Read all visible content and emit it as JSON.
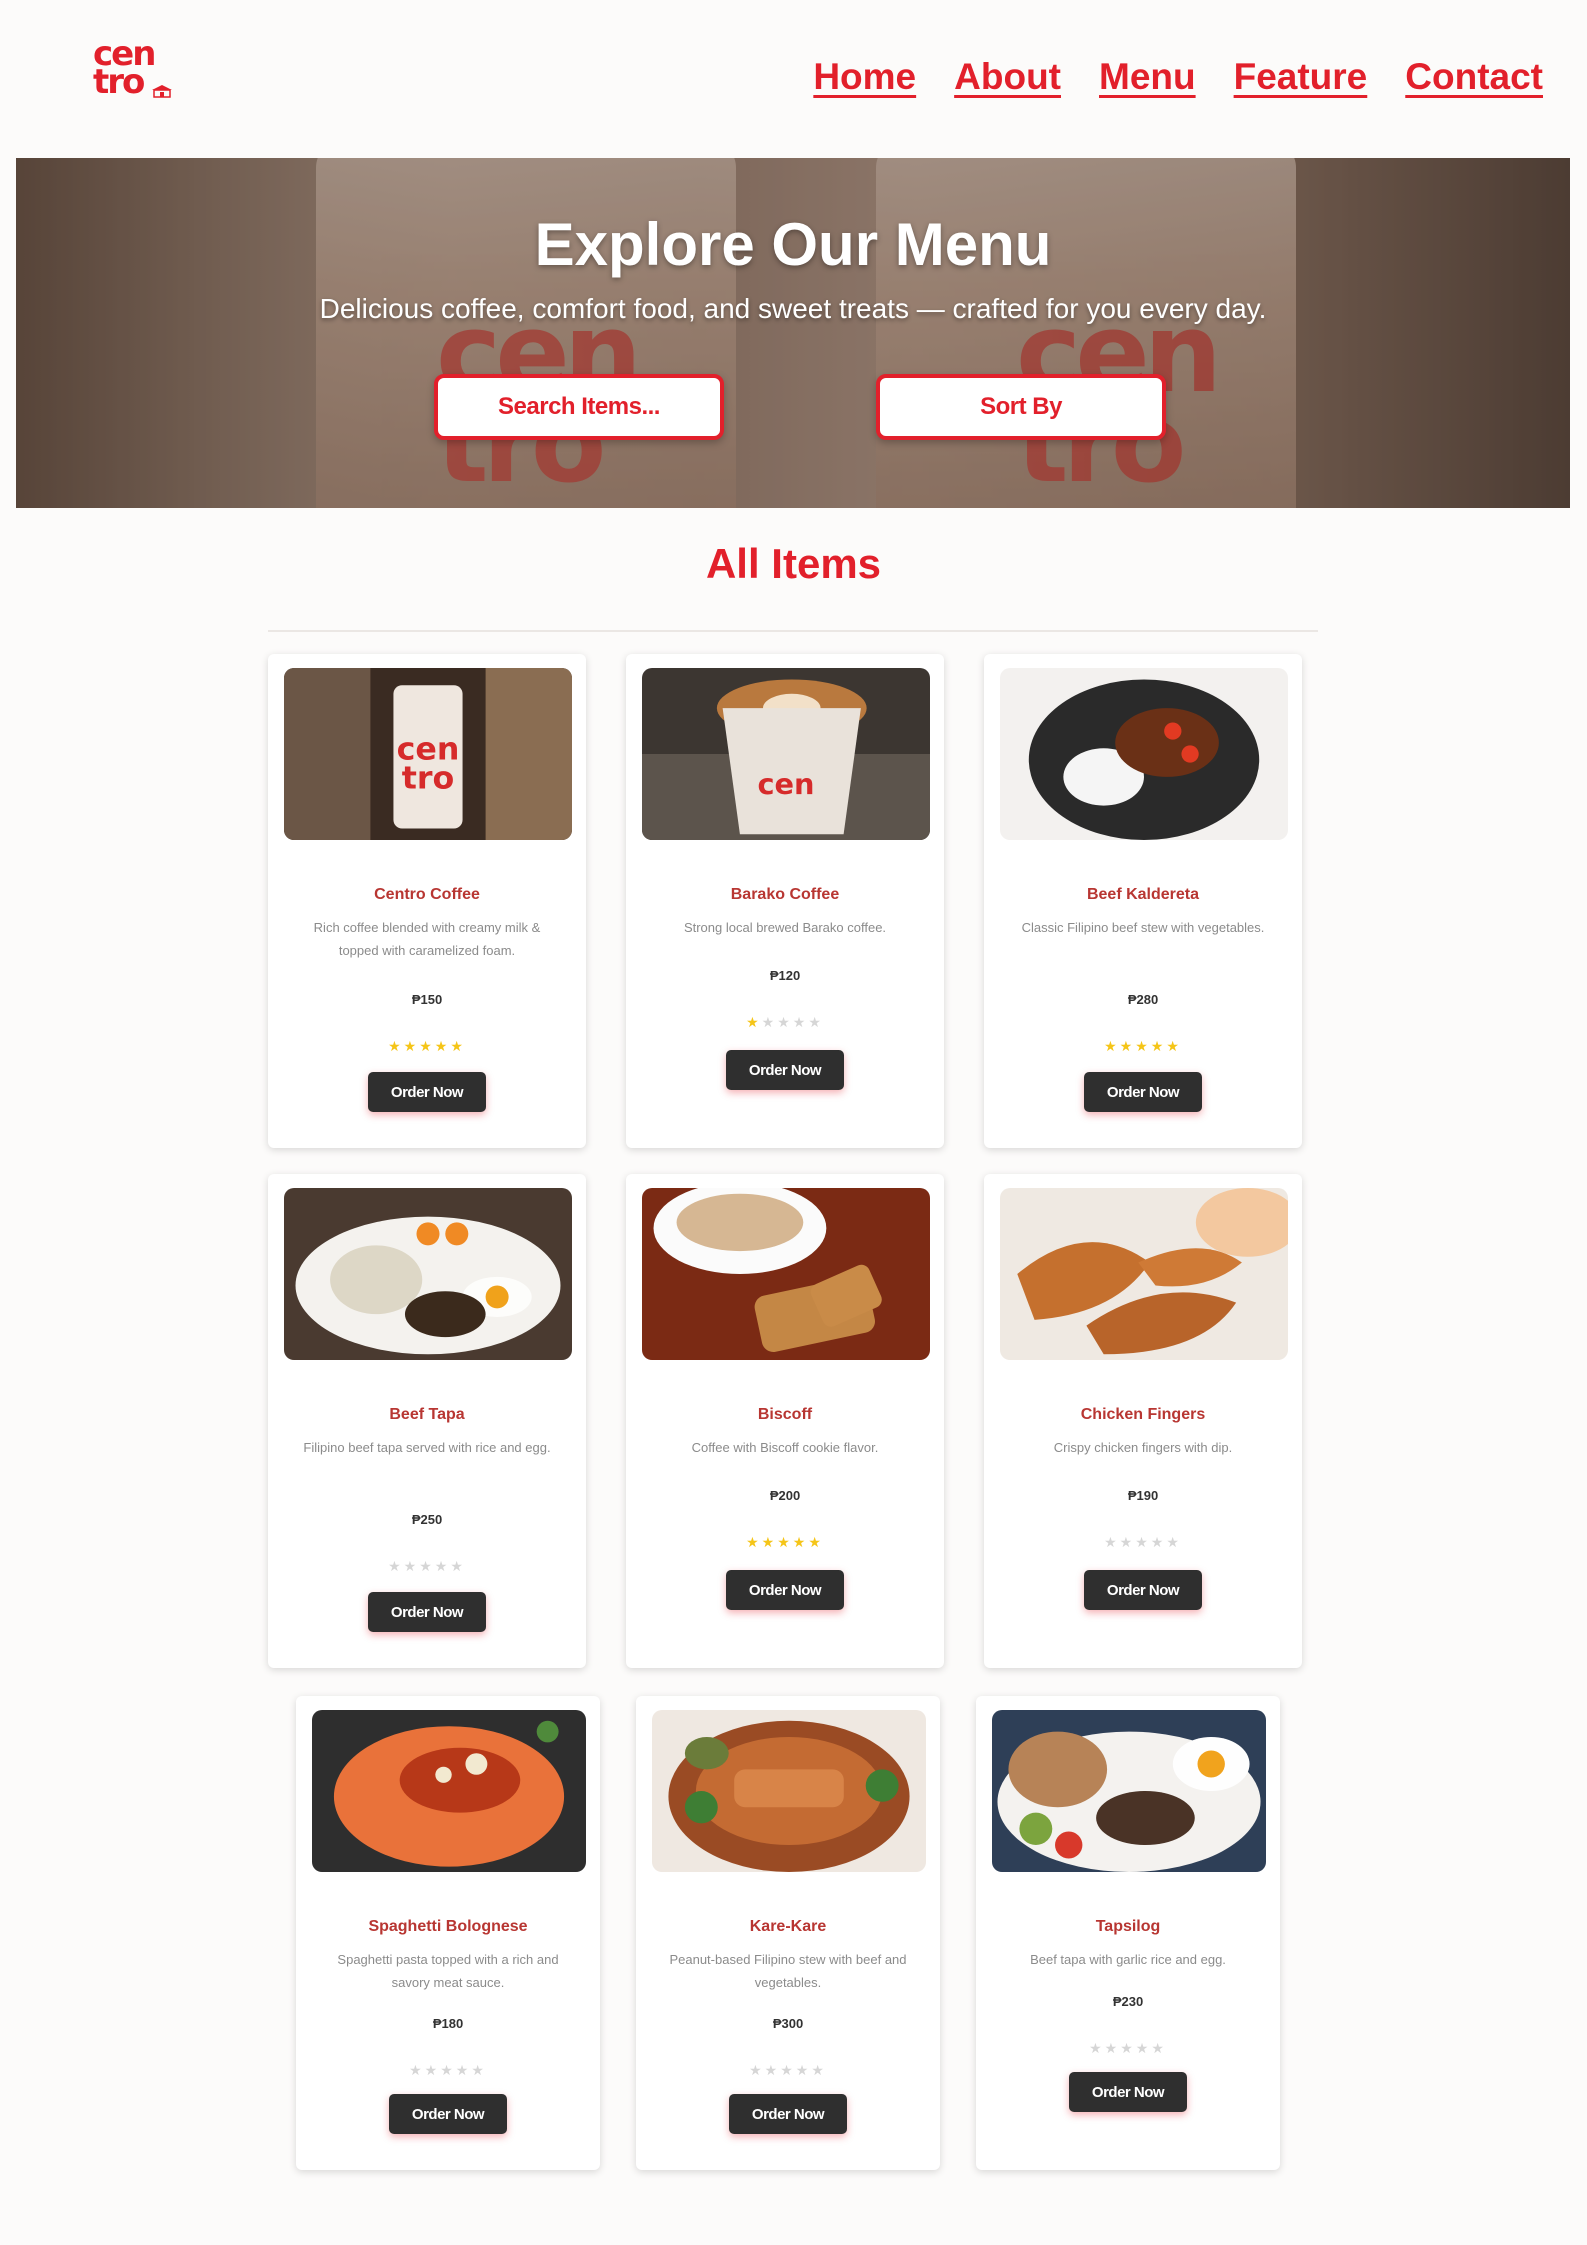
{
  "brand": {
    "line1": "cen",
    "line2": "tro",
    "mark": "store-icon"
  },
  "nav": [
    "Home",
    "About",
    "Menu",
    "Feature",
    "Contact"
  ],
  "hero": {
    "title": "Explore Our Menu",
    "subtitle": "Delicious coffee, comfort food, and sweet treats — crafted for you every day.",
    "search_label": "Search Items...",
    "sort_label": "Sort By"
  },
  "section_title": "All Items",
  "items": [
    {
      "name": "Centro Coffee",
      "desc": "Rich coffee blended with creamy milk & topped with caramelized foam.",
      "price": "₱150",
      "rating": 5,
      "order_label": "Order Now"
    },
    {
      "name": "Barako Coffee",
      "desc": "Strong local brewed Barako coffee.",
      "price": "₱120",
      "rating": 1,
      "order_label": "Order Now"
    },
    {
      "name": "Beef Kaldereta",
      "desc": "Classic Filipino beef stew with vegetables.",
      "price": "₱280",
      "rating": 5,
      "order_label": "Order Now"
    },
    {
      "name": "Beef Tapa",
      "desc": "Filipino beef tapa served with rice and egg.",
      "price": "₱250",
      "rating": 0,
      "order_label": "Order Now"
    },
    {
      "name": "Biscoff",
      "desc": "Coffee with Biscoff cookie flavor.",
      "price": "₱200",
      "rating": 5,
      "order_label": "Order Now"
    },
    {
      "name": "Chicken Fingers",
      "desc": "Crispy chicken fingers with dip.",
      "price": "₱190",
      "rating": 0,
      "order_label": "Order Now"
    },
    {
      "name": "Spaghetti Bolognese",
      "desc": "Spaghetti pasta topped with a rich and savory meat sauce.",
      "price": "₱180",
      "rating": 0,
      "order_label": "Order Now"
    },
    {
      "name": "Kare-Kare",
      "desc": "Peanut-based Filipino stew with beef and vegetables.",
      "price": "₱300",
      "rating": 0,
      "order_label": "Order Now"
    },
    {
      "name": "Tapsilog",
      "desc": "Beef tapa with garlic rice and egg.",
      "price": "₱230",
      "rating": 0,
      "order_label": "Order Now"
    }
  ],
  "colors": {
    "brand_red": "#e2202b",
    "button_dark": "#2f2f2f",
    "star_on": "#f5c518",
    "star_off": "#d6d6d6"
  }
}
